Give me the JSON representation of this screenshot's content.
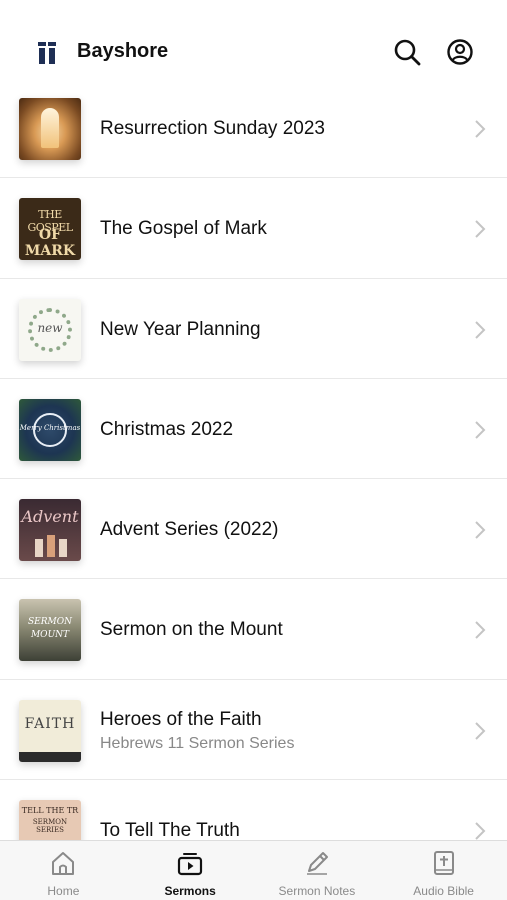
{
  "header": {
    "app_title": "Bayshore"
  },
  "sermons": [
    {
      "title": "Resurrection Sunday 2023",
      "subtitle": ""
    },
    {
      "title": "The Gospel of Mark",
      "subtitle": "",
      "art_text": [
        "THE GOSPEL",
        "OF MARK"
      ]
    },
    {
      "title": "New Year Planning",
      "subtitle": "",
      "art_text": [
        "new"
      ]
    },
    {
      "title": "Christmas 2022",
      "subtitle": "",
      "art_text": [
        "Merry Christmas"
      ]
    },
    {
      "title": "Advent Series (2022)",
      "subtitle": "",
      "art_text": [
        "Advent"
      ]
    },
    {
      "title": "Sermon on the Mount",
      "subtitle": "",
      "art_text": [
        "SERMON",
        "MOUNT"
      ]
    },
    {
      "title": "Heroes of the Faith",
      "subtitle": "Hebrews 11 Sermon Series",
      "art_text": [
        "FAITH"
      ]
    },
    {
      "title": "To Tell The Truth",
      "subtitle": "",
      "art_text": [
        "TELL THE TR",
        "SERMON SERIES"
      ]
    }
  ],
  "tabs": [
    {
      "label": "Home",
      "icon": "home-icon",
      "active": false
    },
    {
      "label": "Sermons",
      "icon": "sermons-icon",
      "active": true
    },
    {
      "label": "Sermon Notes",
      "icon": "pencil-icon",
      "active": false
    },
    {
      "label": "Audio Bible",
      "icon": "bible-icon",
      "active": false
    }
  ],
  "colors": {
    "text": "#111111",
    "muted": "#888888",
    "tab_inactive": "#8a8a8a",
    "logo": "#1f2f55",
    "divider": "#e8e8e8"
  }
}
